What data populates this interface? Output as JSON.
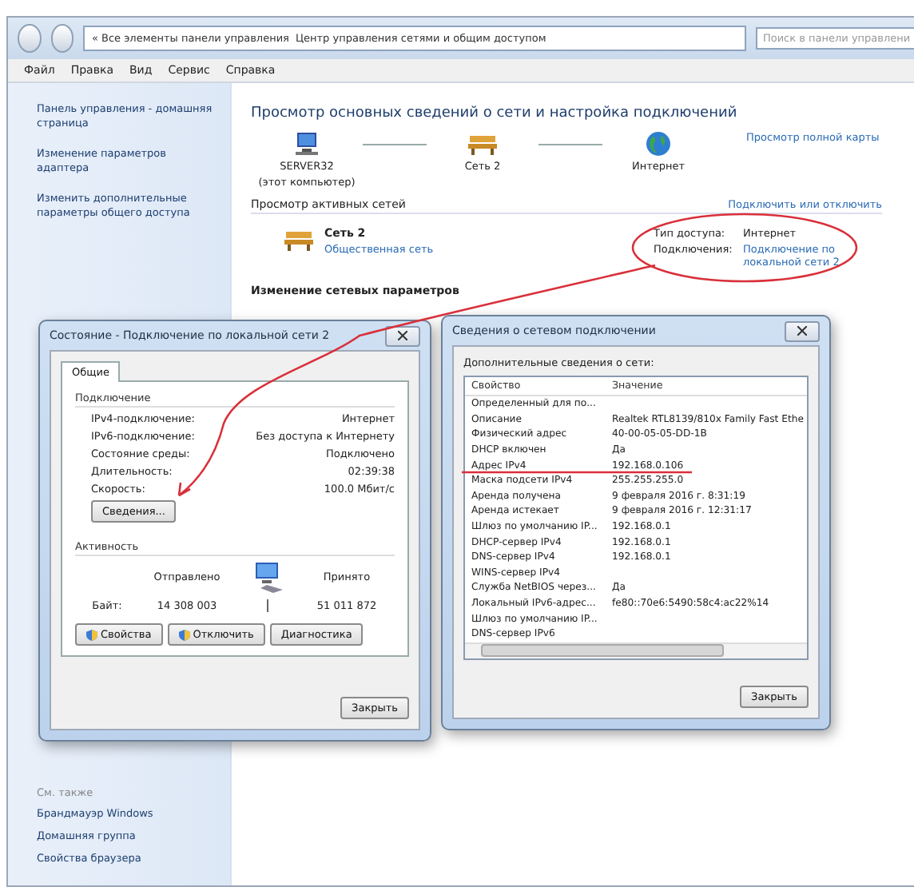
{
  "address_bar": {
    "path": [
      "« Все элементы панели управления",
      "Центр управления сетями и общим доступом"
    ],
    "search": {
      "placeholder": "Поиск в панели управлени"
    }
  },
  "menu": [
    "Файл",
    "Правка",
    "Вид",
    "Сервис",
    "Справка"
  ],
  "sidebar": {
    "links": [
      "Панель управления - домашняя страница",
      "Изменение параметров адаптера",
      "Изменить дополнительные параметры общего доступа"
    ],
    "see_also_title": "См. также",
    "see_also": [
      "Брандмауэр Windows",
      "Домашняя группа",
      "Свойства браузера"
    ]
  },
  "main": {
    "heading": "Просмотр основных сведений о сети и настройка подключений",
    "full_map_link": "Просмотр полной карты",
    "map": [
      {
        "kind": "computer",
        "label": "SERVER32",
        "sublabel": "(этот компьютер)"
      },
      {
        "kind": "network",
        "label": "Сеть 2"
      },
      {
        "kind": "internet",
        "label": "Интернет"
      }
    ],
    "active_title": "Просмотр активных сетей",
    "connect_link": "Подключить или отключить",
    "network": {
      "name": "Сеть 2",
      "type_link": "Общественная сеть",
      "access_label": "Тип доступа:",
      "access_value": "Интернет",
      "connections_label": "Подключения:",
      "connection_link": "Подключение по локальной сети 2"
    },
    "change_title": "Изменение сетевых параметров"
  },
  "status_dialog": {
    "title": "Состояние - Подключение по локальной сети 2",
    "tabs": [
      {
        "label": "Общие",
        "selected": true
      }
    ],
    "connection_group": "Подключение",
    "rows": [
      {
        "label": "IPv4-подключение:",
        "value": "Интернет"
      },
      {
        "label": "IPv6-подключение:",
        "value": "Без доступа к Интернету"
      },
      {
        "label": "Состояние среды:",
        "value": "Подключено"
      },
      {
        "label": "Длительность:",
        "value": "02:39:38"
      },
      {
        "label": "Скорость:",
        "value": "100.0 Мбит/с"
      }
    ],
    "details_button": "Сведения...",
    "activity_group": "Активность",
    "sent_label": "Отправлено",
    "received_label": "Принято",
    "bytes_label": "Байт:",
    "bytes_sent": "14 308 003",
    "bytes_received": "51 011 872",
    "buttons": [
      {
        "label": "Свойства",
        "shield": true
      },
      {
        "label": "Отключить",
        "shield": true
      },
      {
        "label": "Диагностика",
        "shield": false
      }
    ],
    "close_button": "Закрыть"
  },
  "details_dialog": {
    "title": "Сведения о сетевом подключении",
    "caption": "Дополнительные сведения о сети:",
    "columns": [
      "Свойство",
      "Значение"
    ],
    "rows": [
      [
        "Определенный для по...",
        ""
      ],
      [
        "Описание",
        "Realtek RTL8139/810x Family Fast Ethe"
      ],
      [
        "Физический адрес",
        "40-00-05-05-DD-1B"
      ],
      [
        "DHCP включен",
        "Да"
      ],
      [
        "Адрес IPv4",
        "192.168.0.106"
      ],
      [
        "Маска подсети IPv4",
        "255.255.255.0"
      ],
      [
        "Аренда получена",
        "9 февраля 2016 г. 8:31:19"
      ],
      [
        "Аренда истекает",
        "9 февраля 2016 г. 12:31:17"
      ],
      [
        "Шлюз по умолчанию IP...",
        "192.168.0.1"
      ],
      [
        "DHCP-сервер IPv4",
        "192.168.0.1"
      ],
      [
        "DNS-сервер IPv4",
        "192.168.0.1"
      ],
      [
        "WINS-сервер IPv4",
        ""
      ],
      [
        "Служба NetBIOS через...",
        "Да"
      ],
      [
        "Локальный IPv6-адрес...",
        "fe80::70e6:5490:58c4:ac22%14"
      ],
      [
        "Шлюз по умолчанию IP...",
        ""
      ],
      [
        "DNS-сервер IPv6",
        ""
      ]
    ],
    "close_button": "Закрыть"
  }
}
